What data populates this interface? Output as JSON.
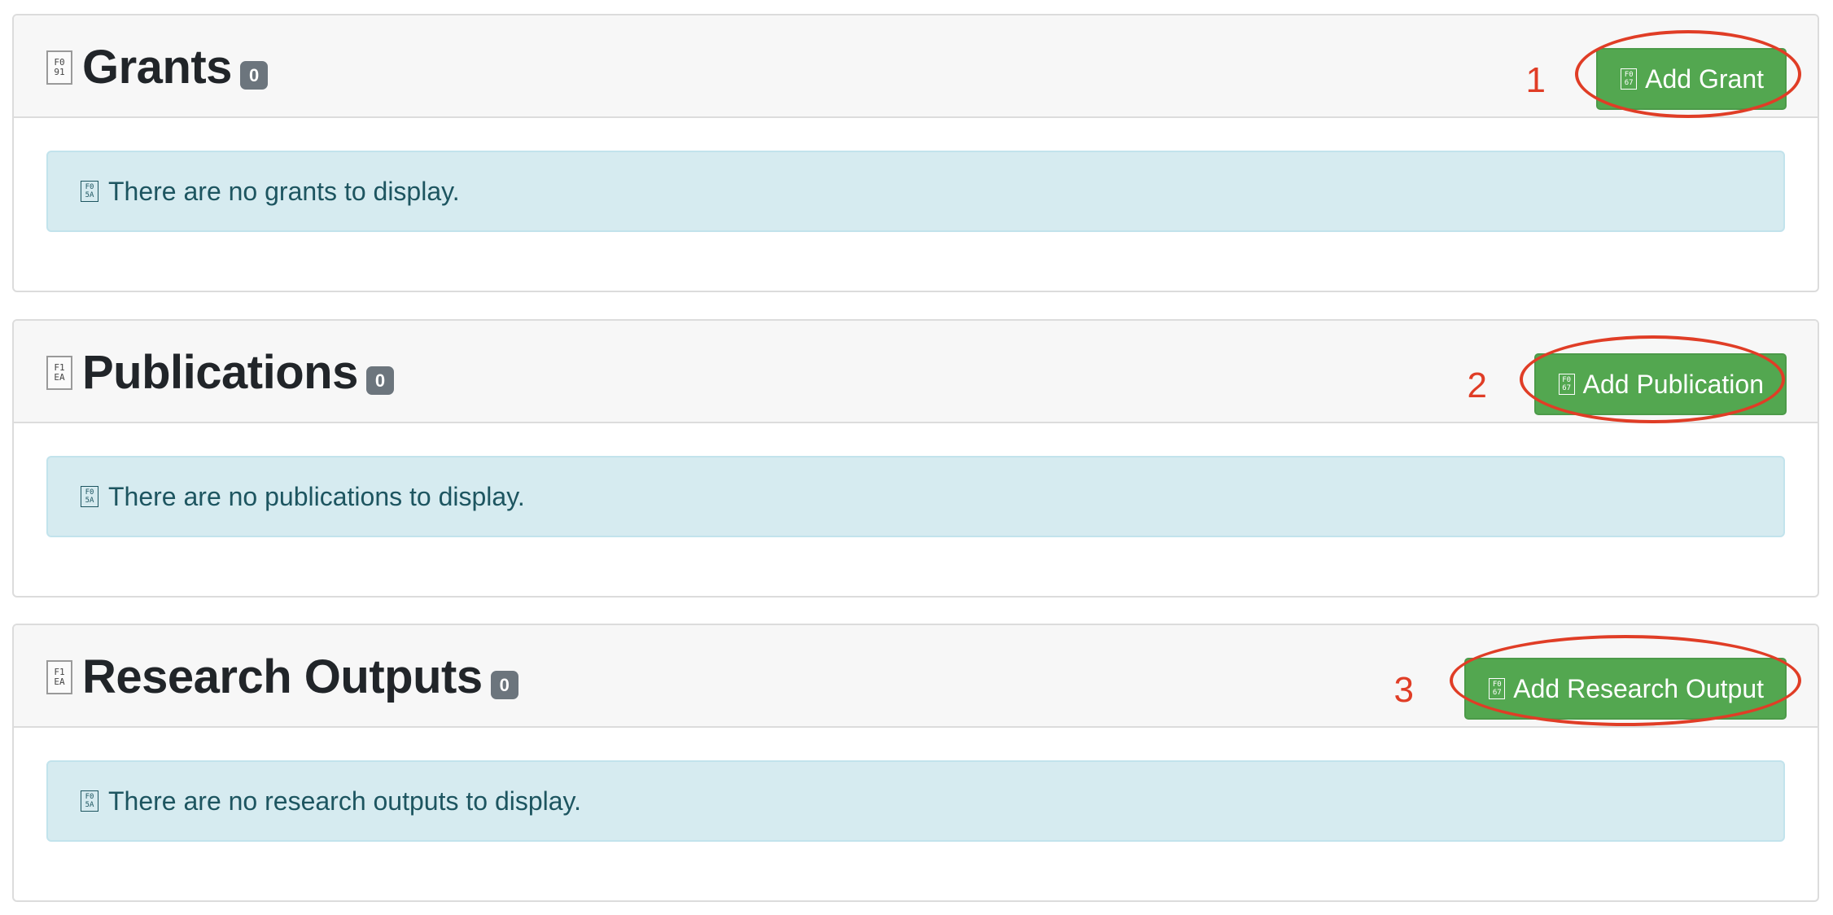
{
  "sections": [
    {
      "title": "Grants",
      "count": "0",
      "step": "1",
      "button_label": "Add Grant",
      "empty_message": "There are no grants to display.",
      "title_icon": "file-icon",
      "button_icon": "plus-icon",
      "message_icon": "info-icon"
    },
    {
      "title": "Publications",
      "count": "0",
      "step": "2",
      "button_label": "Add Publication",
      "empty_message": "There are no publications to display.",
      "title_icon": "file-icon",
      "button_icon": "plus-icon",
      "message_icon": "info-icon"
    },
    {
      "title": "Research Outputs",
      "count": "0",
      "step": "3",
      "button_label": "Add Research Output",
      "empty_message": "There are no research outputs to display.",
      "title_icon": "file-icon",
      "button_icon": "plus-icon",
      "message_icon": "info-icon"
    }
  ],
  "colors": {
    "button_green": "#53a750",
    "annotation_red": "#e03d26",
    "badge_gray": "#6c757d",
    "alert_bg": "#d6ebf0",
    "alert_text": "#1d5560",
    "header_bg": "#f7f7f7"
  }
}
